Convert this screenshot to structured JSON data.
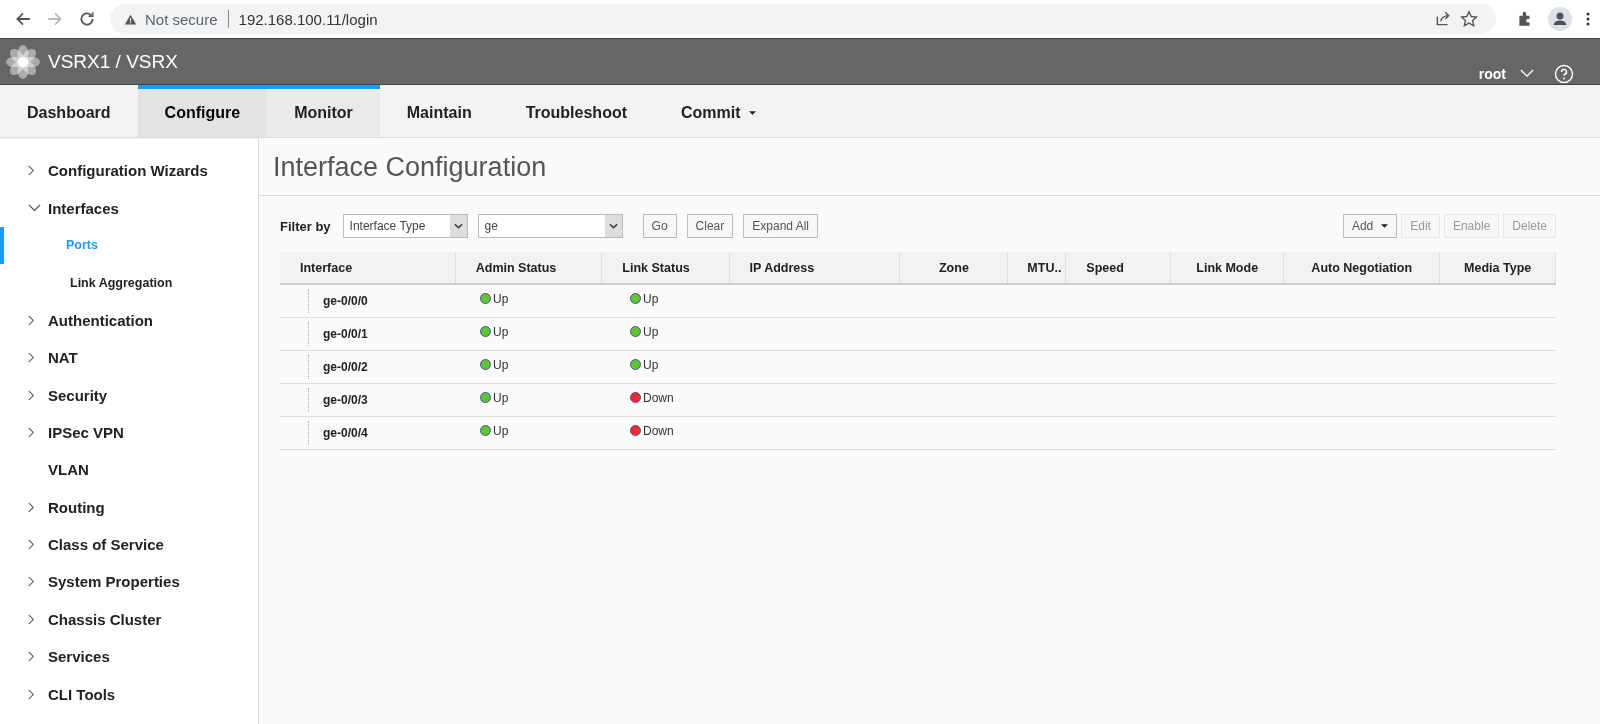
{
  "browser": {
    "security": "Not secure",
    "url": "192.168.100.11/login"
  },
  "header": {
    "title": "VSRX1 / VSRX",
    "user": "root"
  },
  "tabs": [
    {
      "label": "Dashboard",
      "selected": false,
      "hovered": false,
      "dropdown": false
    },
    {
      "label": "Configure",
      "selected": true,
      "hovered": false,
      "dropdown": false
    },
    {
      "label": "Monitor",
      "selected": false,
      "hovered": true,
      "dropdown": false
    },
    {
      "label": "Maintain",
      "selected": false,
      "hovered": false,
      "dropdown": false
    },
    {
      "label": "Troubleshoot",
      "selected": false,
      "hovered": false,
      "dropdown": false
    },
    {
      "label": "Commit",
      "selected": false,
      "hovered": false,
      "dropdown": true
    }
  ],
  "sidebar": {
    "items": [
      {
        "label": "Configuration Wizards",
        "expandable": true,
        "expanded": false
      },
      {
        "label": "Interfaces",
        "expandable": true,
        "expanded": true,
        "children": [
          {
            "label": "Ports",
            "selected": true
          },
          {
            "label": "Link Aggregation",
            "selected": false
          }
        ]
      },
      {
        "label": "Authentication",
        "expandable": true,
        "expanded": false
      },
      {
        "label": "NAT",
        "expandable": true,
        "expanded": false
      },
      {
        "label": "Security",
        "expandable": true,
        "expanded": false
      },
      {
        "label": "IPSec VPN",
        "expandable": true,
        "expanded": false
      },
      {
        "label": "VLAN",
        "expandable": false
      },
      {
        "label": "Routing",
        "expandable": true,
        "expanded": false
      },
      {
        "label": "Class of Service",
        "expandable": true,
        "expanded": false
      },
      {
        "label": "System Properties",
        "expandable": true,
        "expanded": false
      },
      {
        "label": "Chassis Cluster",
        "expandable": true,
        "expanded": false
      },
      {
        "label": "Services",
        "expandable": true,
        "expanded": false
      },
      {
        "label": "CLI Tools",
        "expandable": true,
        "expanded": false
      }
    ]
  },
  "page_title": "Interface Configuration",
  "filter": {
    "label": "Filter by",
    "type_value": "Interface Type",
    "value": "ge",
    "buttons": [
      "Go",
      "Clear",
      "Expand All"
    ]
  },
  "actions": [
    {
      "label": "Add",
      "disabled": false,
      "dropdown": true
    },
    {
      "label": "Edit",
      "disabled": true,
      "dropdown": false
    },
    {
      "label": "Enable",
      "disabled": true,
      "dropdown": false
    },
    {
      "label": "Delete",
      "disabled": true,
      "dropdown": false
    }
  ],
  "table": {
    "columns": [
      "Interface",
      "Admin Status",
      "Link Status",
      "IP Address",
      "Zone",
      "MTU..",
      "Speed",
      "Link Mode",
      "Auto Negotiation",
      "Media Type"
    ],
    "rows": [
      {
        "interface": "ge-0/0/0",
        "admin": {
          "text": "Up",
          "color": "#5fc531"
        },
        "link": {
          "text": "Up",
          "color": "#5fc531"
        }
      },
      {
        "interface": "ge-0/0/1",
        "admin": {
          "text": "Up",
          "color": "#5fc531"
        },
        "link": {
          "text": "Up",
          "color": "#5fc531"
        }
      },
      {
        "interface": "ge-0/0/2",
        "admin": {
          "text": "Up",
          "color": "#5fc531"
        },
        "link": {
          "text": "Up",
          "color": "#5fc531"
        }
      },
      {
        "interface": "ge-0/0/3",
        "admin": {
          "text": "Up",
          "color": "#5fc531"
        },
        "link": {
          "text": "Down",
          "color": "#ee2a2a"
        }
      },
      {
        "interface": "ge-0/0/4",
        "admin": {
          "text": "Up",
          "color": "#5fc531"
        },
        "link": {
          "text": "Down",
          "color": "#ee2a2a"
        }
      }
    ]
  }
}
